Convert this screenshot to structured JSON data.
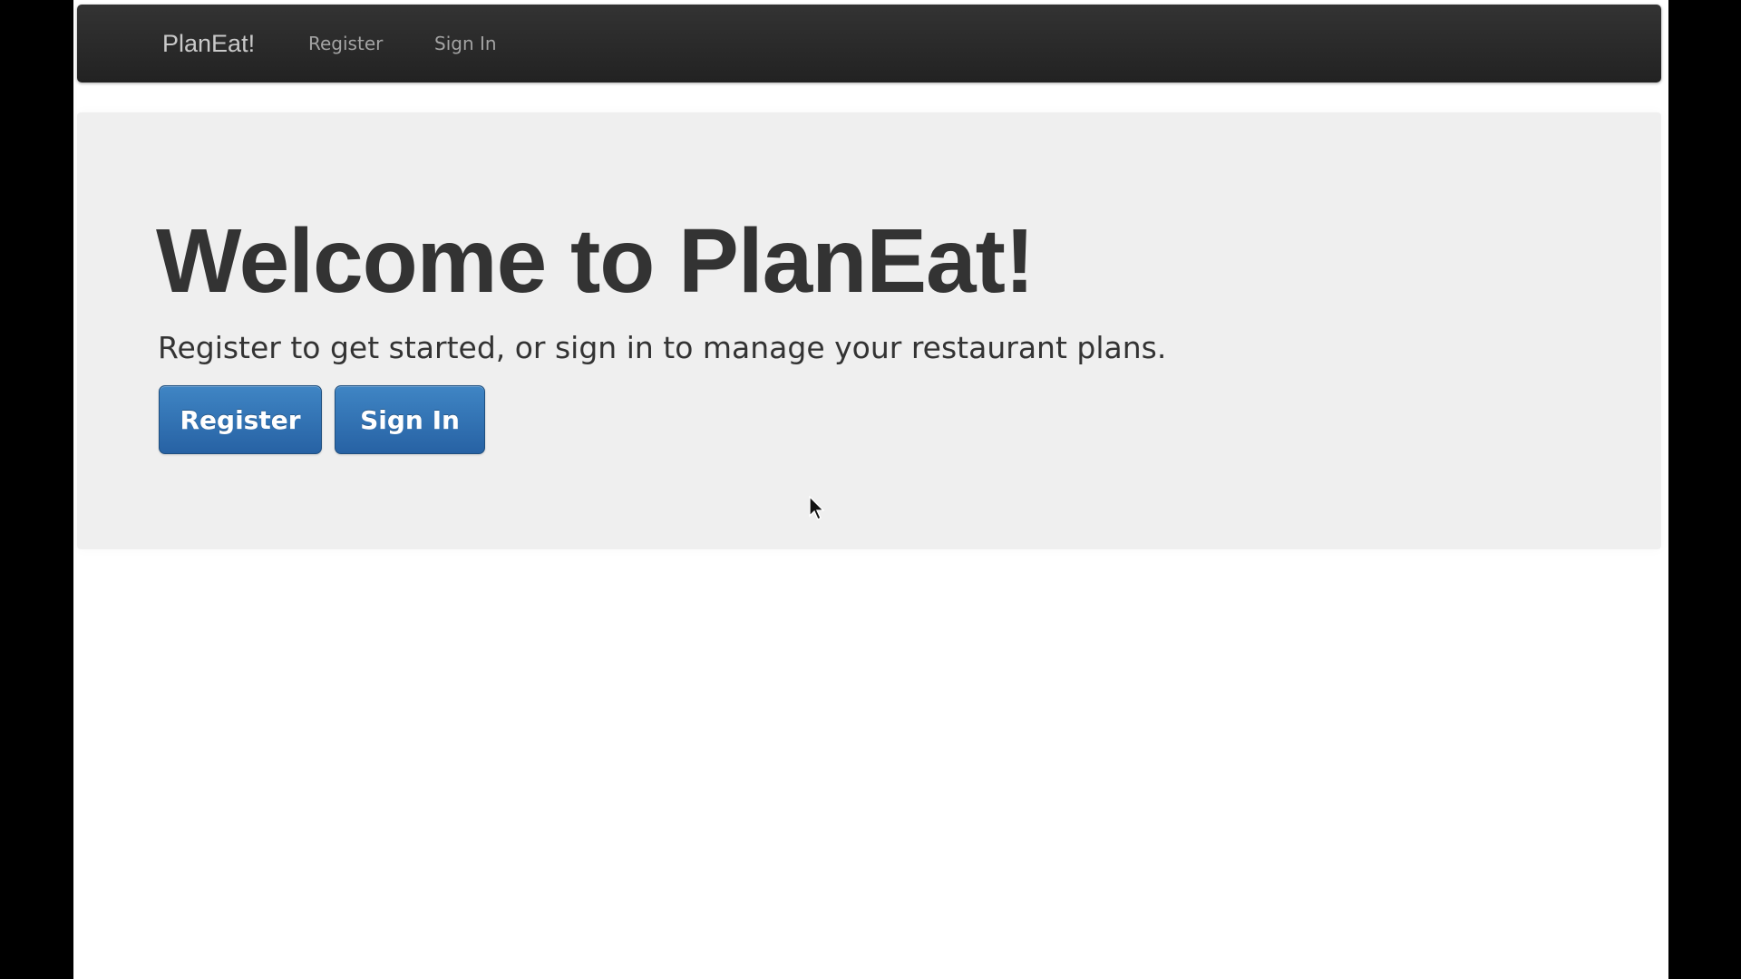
{
  "navbar": {
    "brand": "PlanEat!",
    "links": [
      {
        "label": "Register"
      },
      {
        "label": "Sign In"
      }
    ]
  },
  "hero": {
    "title": "Welcome to PlanEat!",
    "subtitle": "Register to get started, or sign in to manage your restaurant plans.",
    "buttons": [
      {
        "label": "Register"
      },
      {
        "label": "Sign In"
      }
    ]
  },
  "colors": {
    "navbar_bg": "#222222",
    "brand_text": "#c9c9c9",
    "nav_link_text": "#a3a3a3",
    "hero_bg": "#efefef",
    "hero_text": "#333333",
    "button_primary": "#2f6fb2",
    "page_bg": "#ffffff"
  },
  "icons": {
    "cursor": "mouse-pointer-icon"
  }
}
